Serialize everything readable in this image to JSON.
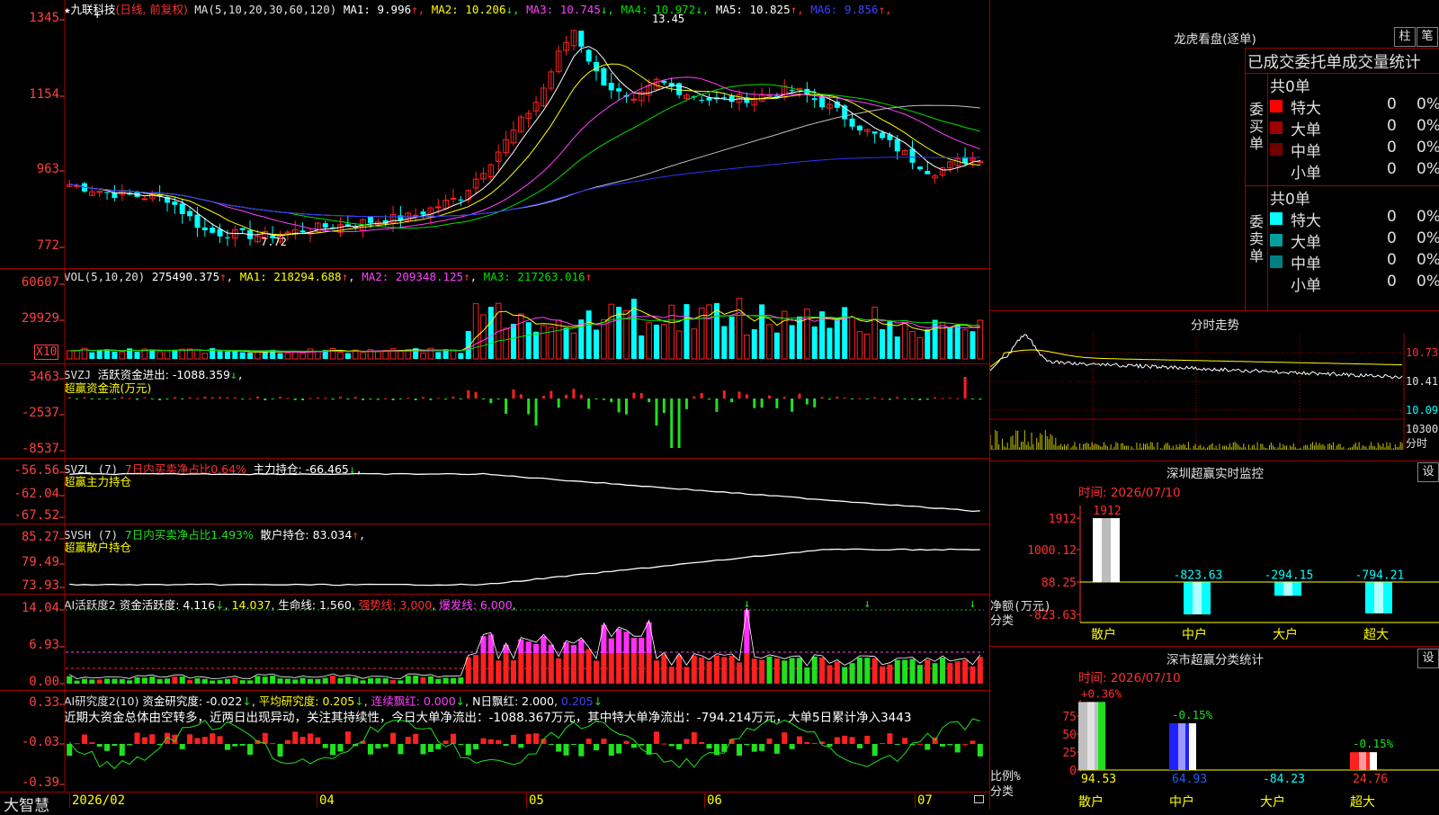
{
  "stock": {
    "star": "★",
    "name": "九联科技",
    "mode": "(日线, 前复权)"
  },
  "ma": {
    "prefix": "MA(5,10,20,30,60,120)",
    "items": [
      {
        "label": "MA1: 9.996",
        "arrow": "↑",
        "color": "#ffffff"
      },
      {
        "label": "MA2: 10.206",
        "arrow": "↓",
        "color": "#ffff00"
      },
      {
        "label": "MA3: 10.745",
        "arrow": "↓",
        "color": "#ff40ff"
      },
      {
        "label": "MA4: 10.972",
        "arrow": "↓",
        "color": "#00e000"
      },
      {
        "label": "MA5: 10.825",
        "arrow": "↑",
        "color": "#ffffff"
      },
      {
        "label": "MA6: 9.856",
        "arrow": "↑",
        "color": "#4040ff"
      }
    ]
  },
  "price_axis": {
    "labels": [
      "13.45",
      "11.54",
      "9.63",
      "7.72"
    ],
    "high_marker": "13.45",
    "low_marker": "7.72"
  },
  "vol": {
    "title": "VOL(5,10,20)",
    "value": "275490.375",
    "arrow": "↑",
    "ma1": "MA1: 218294.688",
    "ma2": "MA2: 209348.125",
    "ma3": "MA3: 217263.016",
    "axis": [
      "60607",
      "29929"
    ],
    "unit": "X10"
  },
  "svzj": {
    "title": "SVZJ",
    "label": "活跃资金进出: -1088.359",
    "arrow": "↓",
    "subtitle": "超赢资金流(万元)",
    "axis": [
      "3463",
      "-2537",
      "-8537"
    ]
  },
  "svzl": {
    "title": "SVZL (7)",
    "ratio": "7日内买卖净占比0.64%",
    "label": "主力持仓: -66.465",
    "arrow": "↓",
    "subtitle": "超赢主力持仓",
    "axis": [
      "-56.56",
      "-62.04",
      "-67.52"
    ]
  },
  "svsh": {
    "title": "SVSH (7)",
    "ratio": "7日内买卖净占比1.493%",
    "label": "散户持仓: 83.034",
    "arrow": "↑",
    "subtitle": "超赢散户持仓",
    "axis": [
      "85.27",
      "79.49",
      "73.93"
    ]
  },
  "ai1": {
    "title": "AI活跃度2",
    "active": "资金活跃度: 4.116",
    "a1": "↓",
    "v2": "14.037",
    "life": "生命线: 1.560",
    "strong": "强势线: 3.000",
    "burst": "爆发线: 6.000",
    "axis": [
      "14.04",
      "6.93",
      "0.00"
    ]
  },
  "ai2": {
    "title": "AI研究度2(10)",
    "study": "资金研究度: -0.022",
    "avg": "平均研究度: 0.205",
    "lian": "连续飘红: 0.000",
    "nday": "N日飘红: 2.000",
    "last": "0.205",
    "comment": "近期大资金总体由空转多，近两日出现异动，关注其持续性，今日大单净流出：-1088.367万元，其中特大单净流出：-794.214万元，大单5日累计净入3443",
    "axis": [
      "0.33",
      "-0.03",
      "-0.39"
    ]
  },
  "x_axis": {
    "brand": "大智慧",
    "labels": [
      "2026/02",
      "04",
      "05",
      "06",
      "07"
    ]
  },
  "right": {
    "lhb_title": "龙虎看盘(逐单)",
    "btn_col": "柱",
    "btn_pen": "笔",
    "stat_header": "已成交委托单成交量统计",
    "buy": {
      "label": "委买单",
      "count": "共0单",
      "rows": [
        {
          "name": "特大",
          "v": "0",
          "p": "0%",
          "color": "#ff0000"
        },
        {
          "name": "大单",
          "v": "0",
          "p": "0%",
          "color": "#a00000"
        },
        {
          "name": "中单",
          "v": "0",
          "p": "0%",
          "color": "#700000"
        },
        {
          "name": "小单",
          "v": "0",
          "p": "0%",
          "color": ""
        }
      ]
    },
    "sell": {
      "label": "委卖单",
      "count": "共0单",
      "rows": [
        {
          "name": "特大",
          "v": "0",
          "p": "0%",
          "color": "#00ffff"
        },
        {
          "name": "大单",
          "v": "0",
          "p": "0%",
          "color": "#00a0a0"
        },
        {
          "name": "中单",
          "v": "0",
          "p": "0%",
          "color": "#008080"
        },
        {
          "name": "小单",
          "v": "0",
          "p": "0%",
          "color": ""
        }
      ]
    },
    "intraday": {
      "title": "分时走势",
      "labels": [
        "10.73",
        "10.41",
        "10.09"
      ],
      "vol_label": "10300",
      "fen": "分时"
    },
    "monitor": {
      "title": "深圳超赢实时监控",
      "btn": "设",
      "time": "时间: 2026/07/10",
      "axis": [
        "1912",
        "1000.12",
        "88.25",
        "-823.63"
      ],
      "ylabel": "净额(万元)",
      "xtitle": "分类",
      "bars": [
        {
          "name": "散户",
          "value": 1912,
          "label": "1912"
        },
        {
          "name": "中户",
          "value": -823.63,
          "label": "-823.63"
        },
        {
          "name": "大户",
          "value": -294.15,
          "label": "-294.15"
        },
        {
          "name": "超大",
          "value": -794.21,
          "label": "-794.21"
        }
      ]
    },
    "classify": {
      "title": "深市超赢分类统计",
      "btn": "设",
      "time": "时间: 2026/07/10",
      "axis": [
        "75",
        "50",
        "25",
        "0"
      ],
      "ylabel": "比例%",
      "xtitle": "分类",
      "bars": [
        {
          "name": "散户",
          "bottom": "94.53",
          "top": "+0.36%",
          "height": 94.53
        },
        {
          "name": "中户",
          "bottom": "64.93",
          "top": "-0.15%",
          "height": 64.93
        },
        {
          "name": "大户",
          "bottom": "-84.23",
          "top": "",
          "height": 0
        },
        {
          "name": "超大",
          "bottom": "24.76",
          "top": "-0.15%",
          "height": 24.76
        }
      ]
    }
  },
  "colors": {
    "up": "#ff2020",
    "down": "#00ffff",
    "axis": "#ff4040",
    "border": "#a00000",
    "green": "#20e020",
    "magenta": "#ff30ff",
    "yellow": "#ffff00"
  }
}
